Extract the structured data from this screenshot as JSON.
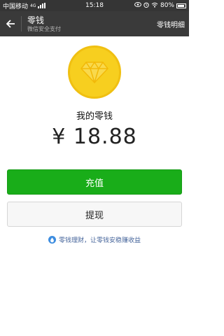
{
  "status_bar": {
    "carrier": "中国移动",
    "network": "4G",
    "time": "15:18",
    "battery": "80%"
  },
  "header": {
    "title": "零钱",
    "subtitle": "微信安全支付",
    "details_link": "零钱明细"
  },
  "wallet": {
    "label": "我的零钱",
    "amount": "¥ 18.88"
  },
  "actions": {
    "recharge": "充值",
    "withdraw": "提现"
  },
  "tip": {
    "text": "零钱理财，让零钱安稳赚收益"
  },
  "colors": {
    "accent_green": "#19ad19",
    "coin_yellow": "#f7cf1f",
    "header_dark": "#3a3a3a",
    "link_blue": "#46659b"
  }
}
